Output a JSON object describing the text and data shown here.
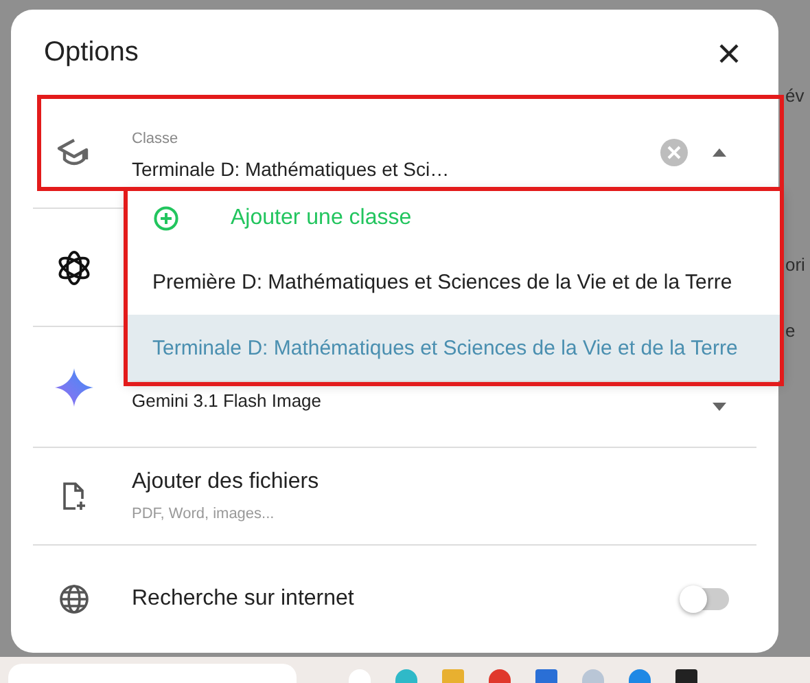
{
  "background": {
    "fragments": [
      "év",
      "ori",
      "e"
    ]
  },
  "dialog": {
    "title": "Options"
  },
  "class_field": {
    "label": "Classe",
    "value": "Terminale D: Mathématiques et Sci…",
    "expanded": true,
    "highlighted": true
  },
  "class_menu": {
    "add_label": "Ajouter une classe",
    "highlighted": true,
    "options": [
      {
        "label": "Première D: Mathématiques et Sciences de la Vie et de la Terre",
        "selected": false
      },
      {
        "label": "Terminale D: Mathématiques et Sciences de la Vie et de la Terre",
        "selected": true
      }
    ]
  },
  "model_field": {
    "value": "Gemini 3.1 Flash Image"
  },
  "files": {
    "title": "Ajouter des fichiers",
    "hint": "PDF, Word, images..."
  },
  "web_search": {
    "label": "Recherche sur internet",
    "on": false
  }
}
